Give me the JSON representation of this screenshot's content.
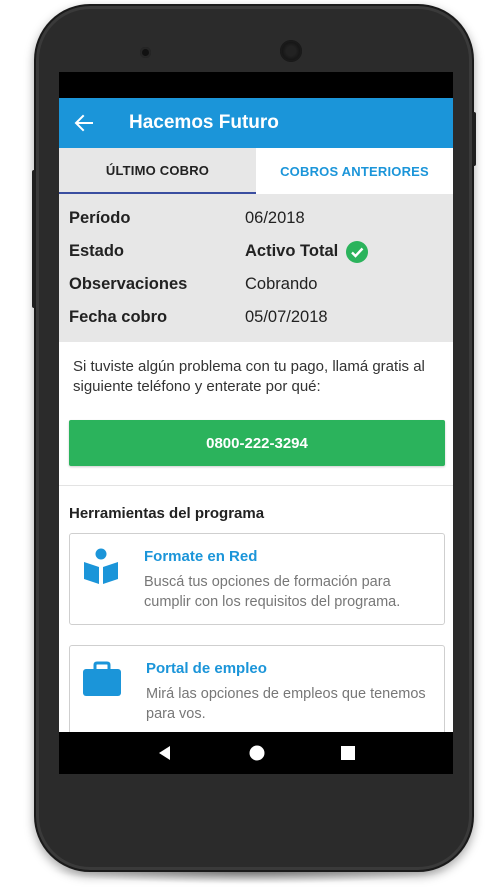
{
  "app": {
    "title": "Hacemos Futuro"
  },
  "tabs": [
    {
      "label": "ÚLTIMO COBRO",
      "active": true
    },
    {
      "label": "COBROS ANTERIORES",
      "active": false
    }
  ],
  "payment": {
    "rows": [
      {
        "label": "Período",
        "value": "06/2018"
      },
      {
        "label": "Estado",
        "value": "Activo Total",
        "icon": "check-circle-icon"
      },
      {
        "label": "Observaciones",
        "value": "Cobrando"
      },
      {
        "label": "Fecha cobro",
        "value": "05/07/2018"
      }
    ]
  },
  "help": {
    "text": "Si tuviste algún problema con tu pago, llamá gratis al siguiente teléfono y enterate por qué:",
    "phone_label": "0800-222-3294"
  },
  "tools": {
    "title": "Herramientas del programa",
    "cards": [
      {
        "title": "Formate en Red",
        "description": "Buscá tus opciones de formación para cumplir con los requisitos del programa.",
        "icon": "reading-person-icon"
      },
      {
        "title": "Portal de empleo",
        "description": "Mirá las opciones de empleos que tenemos para vos.",
        "icon": "briefcase-icon"
      }
    ]
  },
  "colors": {
    "primary": "#1b95d9",
    "success": "#2bb35c",
    "panel": "#e7e7e7",
    "tab_indicator": "#3a4ea0"
  }
}
